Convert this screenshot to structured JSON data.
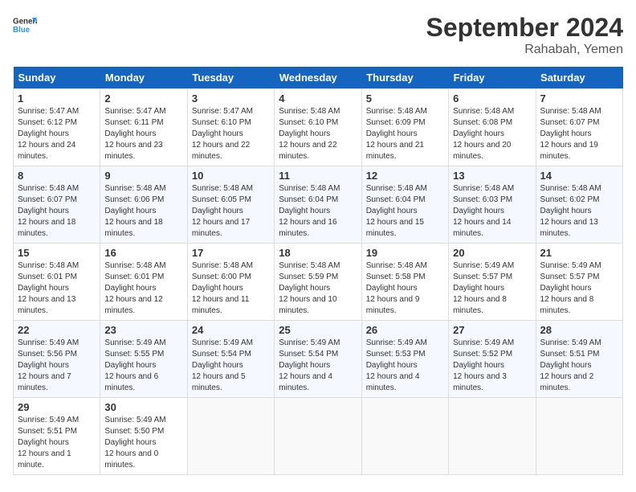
{
  "header": {
    "logo_general": "General",
    "logo_blue": "Blue",
    "month": "September 2024",
    "location": "Rahabah, Yemen"
  },
  "days_of_week": [
    "Sunday",
    "Monday",
    "Tuesday",
    "Wednesday",
    "Thursday",
    "Friday",
    "Saturday"
  ],
  "weeks": [
    [
      {
        "day": "1",
        "sunrise": "5:47 AM",
        "sunset": "6:12 PM",
        "daylight": "12 hours and 24 minutes."
      },
      {
        "day": "2",
        "sunrise": "5:47 AM",
        "sunset": "6:11 PM",
        "daylight": "12 hours and 23 minutes."
      },
      {
        "day": "3",
        "sunrise": "5:47 AM",
        "sunset": "6:10 PM",
        "daylight": "12 hours and 22 minutes."
      },
      {
        "day": "4",
        "sunrise": "5:48 AM",
        "sunset": "6:10 PM",
        "daylight": "12 hours and 22 minutes."
      },
      {
        "day": "5",
        "sunrise": "5:48 AM",
        "sunset": "6:09 PM",
        "daylight": "12 hours and 21 minutes."
      },
      {
        "day": "6",
        "sunrise": "5:48 AM",
        "sunset": "6:08 PM",
        "daylight": "12 hours and 20 minutes."
      },
      {
        "day": "7",
        "sunrise": "5:48 AM",
        "sunset": "6:07 PM",
        "daylight": "12 hours and 19 minutes."
      }
    ],
    [
      {
        "day": "8",
        "sunrise": "5:48 AM",
        "sunset": "6:07 PM",
        "daylight": "12 hours and 18 minutes."
      },
      {
        "day": "9",
        "sunrise": "5:48 AM",
        "sunset": "6:06 PM",
        "daylight": "12 hours and 18 minutes."
      },
      {
        "day": "10",
        "sunrise": "5:48 AM",
        "sunset": "6:05 PM",
        "daylight": "12 hours and 17 minutes."
      },
      {
        "day": "11",
        "sunrise": "5:48 AM",
        "sunset": "6:04 PM",
        "daylight": "12 hours and 16 minutes."
      },
      {
        "day": "12",
        "sunrise": "5:48 AM",
        "sunset": "6:04 PM",
        "daylight": "12 hours and 15 minutes."
      },
      {
        "day": "13",
        "sunrise": "5:48 AM",
        "sunset": "6:03 PM",
        "daylight": "12 hours and 14 minutes."
      },
      {
        "day": "14",
        "sunrise": "5:48 AM",
        "sunset": "6:02 PM",
        "daylight": "12 hours and 13 minutes."
      }
    ],
    [
      {
        "day": "15",
        "sunrise": "5:48 AM",
        "sunset": "6:01 PM",
        "daylight": "12 hours and 13 minutes."
      },
      {
        "day": "16",
        "sunrise": "5:48 AM",
        "sunset": "6:01 PM",
        "daylight": "12 hours and 12 minutes."
      },
      {
        "day": "17",
        "sunrise": "5:48 AM",
        "sunset": "6:00 PM",
        "daylight": "12 hours and 11 minutes."
      },
      {
        "day": "18",
        "sunrise": "5:48 AM",
        "sunset": "5:59 PM",
        "daylight": "12 hours and 10 minutes."
      },
      {
        "day": "19",
        "sunrise": "5:48 AM",
        "sunset": "5:58 PM",
        "daylight": "12 hours and 9 minutes."
      },
      {
        "day": "20",
        "sunrise": "5:49 AM",
        "sunset": "5:57 PM",
        "daylight": "12 hours and 8 minutes."
      },
      {
        "day": "21",
        "sunrise": "5:49 AM",
        "sunset": "5:57 PM",
        "daylight": "12 hours and 8 minutes."
      }
    ],
    [
      {
        "day": "22",
        "sunrise": "5:49 AM",
        "sunset": "5:56 PM",
        "daylight": "12 hours and 7 minutes."
      },
      {
        "day": "23",
        "sunrise": "5:49 AM",
        "sunset": "5:55 PM",
        "daylight": "12 hours and 6 minutes."
      },
      {
        "day": "24",
        "sunrise": "5:49 AM",
        "sunset": "5:54 PM",
        "daylight": "12 hours and 5 minutes."
      },
      {
        "day": "25",
        "sunrise": "5:49 AM",
        "sunset": "5:54 PM",
        "daylight": "12 hours and 4 minutes."
      },
      {
        "day": "26",
        "sunrise": "5:49 AM",
        "sunset": "5:53 PM",
        "daylight": "12 hours and 4 minutes."
      },
      {
        "day": "27",
        "sunrise": "5:49 AM",
        "sunset": "5:52 PM",
        "daylight": "12 hours and 3 minutes."
      },
      {
        "day": "28",
        "sunrise": "5:49 AM",
        "sunset": "5:51 PM",
        "daylight": "12 hours and 2 minutes."
      }
    ],
    [
      {
        "day": "29",
        "sunrise": "5:49 AM",
        "sunset": "5:51 PM",
        "daylight": "12 hours and 1 minute."
      },
      {
        "day": "30",
        "sunrise": "5:49 AM",
        "sunset": "5:50 PM",
        "daylight": "12 hours and 0 minutes."
      },
      null,
      null,
      null,
      null,
      null
    ]
  ]
}
